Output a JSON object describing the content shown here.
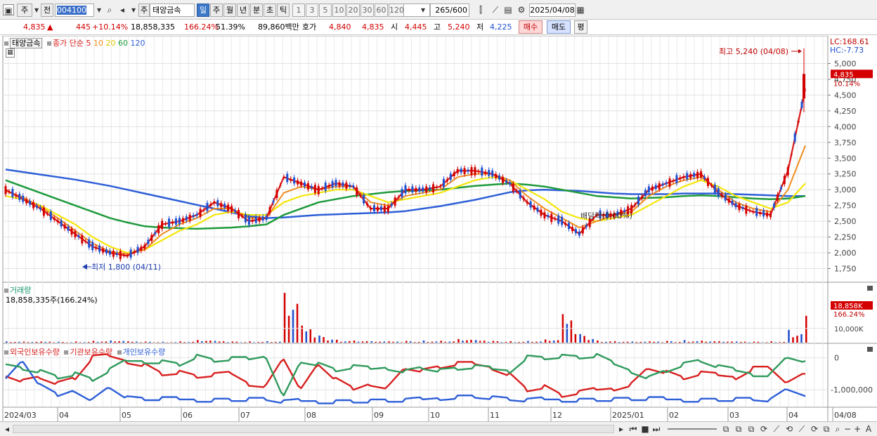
{
  "toolbar": {
    "market_label": "주",
    "prev_label": "전",
    "code": "004100",
    "stock_name": "태양금속",
    "period_tabs": [
      {
        "label": "일",
        "selected": true
      },
      {
        "label": "주",
        "selected": false
      },
      {
        "label": "월",
        "selected": false
      },
      {
        "label": "년",
        "selected": false
      },
      {
        "label": "분",
        "selected": false
      },
      {
        "label": "초",
        "selected": false
      },
      {
        "label": "틱",
        "selected": false
      }
    ],
    "interval_buttons": [
      "1",
      "3",
      "5",
      "10",
      "20",
      "30",
      "60",
      "120"
    ],
    "count": "265",
    "count_total": "/600",
    "date": "2025/04/08"
  },
  "quote": {
    "price": "4,835",
    "change_arrow": "▲",
    "change": "445",
    "change_pct": "+10.14%",
    "volume": "18,858,335",
    "volume_ratio": "166.24%",
    "turnover": "51.39%",
    "amount": "89,860백만",
    "bid_label": "호가",
    "bid1": "4,840",
    "bid2": "4,835",
    "open_label": "시",
    "open": "4,445",
    "high_label": "고",
    "high": "5,240",
    "low_label": "저",
    "low": "4,225",
    "buy_label": "매수",
    "sell_label": "매도",
    "avg_label": "평"
  },
  "legend": {
    "stock": "태양금속",
    "ma_title": "종가 단순",
    "ma_periods": [
      "5",
      "10",
      "20",
      "60",
      "120"
    ],
    "volume_title": "거래량",
    "volume_value": "18,858,335주(166.24%)",
    "holdings": [
      "외국인보유수량",
      "기관보유수량",
      "개인보유수량"
    ]
  },
  "annotations": {
    "high": "최고 5,240 (04/08)",
    "low": "최저 1,800 (04/11)",
    "dividend": "배당락(0.00%)",
    "lc": "LC:168.61",
    "hc": "HC:-7.73",
    "price_tag": "4,835",
    "pct_tag": "10.14%",
    "vol_tag": "18,858K",
    "vol_pct_tag": "166.24%"
  },
  "colors": {
    "up": "#d40000",
    "down": "#1f4fd0",
    "ma5": "#d81818",
    "ma10": "#f08c1e",
    "ma20": "#f5e60a",
    "ma60": "#1e9a3c",
    "ma120": "#2e5fd8",
    "foreign": "#d82020",
    "institution": "#2e5fd8",
    "individual": "#2f9a5c"
  },
  "chart_data": [
    {
      "type": "line",
      "title": "태양금속 일봉",
      "x_ticks": [
        "2024/03",
        "04",
        "05",
        "06",
        "07",
        "08",
        "09",
        "10",
        "11",
        "12",
        "2025/01",
        "02",
        "03",
        "04",
        "04/08"
      ],
      "ylim": [
        1600,
        5350
      ],
      "y_ticks": [
        1750,
        2000,
        2250,
        2500,
        2750,
        3000,
        3250,
        3500,
        3750,
        4000,
        4250,
        4500,
        4750,
        5000
      ],
      "series": [
        {
          "name": "5",
          "values": [
            3000,
            2850,
            2700,
            2500,
            2300,
            2100,
            2000,
            1950,
            2100,
            2450,
            2500,
            2600,
            2800,
            2700,
            2500,
            2550,
            3200,
            3100,
            3000,
            3100,
            3050,
            2700,
            2700,
            3000,
            3000,
            3050,
            3300,
            3300,
            3250,
            3100,
            2800,
            2600,
            2500,
            2300,
            2600,
            2600,
            2700,
            3000,
            3100,
            3200,
            3250,
            2950,
            2750,
            2650,
            2600,
            3300,
            4600
          ]
        },
        {
          "name": "10",
          "values": [
            2980,
            2880,
            2730,
            2550,
            2350,
            2150,
            2020,
            1980,
            2050,
            2300,
            2450,
            2550,
            2700,
            2700,
            2550,
            2550,
            2950,
            3050,
            3000,
            3050,
            3050,
            2800,
            2750,
            2900,
            2950,
            3000,
            3200,
            3250,
            3250,
            3150,
            2900,
            2700,
            2550,
            2400,
            2500,
            2600,
            2650,
            2900,
            3050,
            3150,
            3200,
            3000,
            2800,
            2700,
            2650,
            3000,
            3700
          ]
        },
        {
          "name": "20",
          "values": [
            2900,
            2850,
            2750,
            2600,
            2450,
            2250,
            2100,
            2000,
            2050,
            2200,
            2350,
            2450,
            2600,
            2650,
            2600,
            2600,
            2800,
            2900,
            2950,
            3000,
            3000,
            2900,
            2800,
            2850,
            2900,
            2950,
            3050,
            3150,
            3200,
            3150,
            3000,
            2850,
            2650,
            2550,
            2500,
            2550,
            2600,
            2750,
            2900,
            3050,
            3150,
            3050,
            2900,
            2800,
            2700,
            2800,
            3100
          ]
        },
        {
          "name": "60",
          "values": [
            3150,
            3050,
            2950,
            2850,
            2750,
            2650,
            2550,
            2480,
            2420,
            2400,
            2390,
            2380,
            2390,
            2400,
            2420,
            2450,
            2600,
            2700,
            2800,
            2850,
            2900,
            2930,
            2960,
            2980,
            2990,
            3000,
            3030,
            3060,
            3080,
            3100,
            3080,
            3050,
            3000,
            2950,
            2900,
            2880,
            2860,
            2870,
            2880,
            2900,
            2910,
            2900,
            2880,
            2860,
            2850,
            2860,
            2900
          ]
        },
        {
          "name": "120",
          "values": [
            3320,
            3280,
            3240,
            3200,
            3160,
            3110,
            3060,
            3000,
            2940,
            2880,
            2820,
            2760,
            2700,
            2640,
            2580,
            2550,
            2560,
            2580,
            2600,
            2610,
            2620,
            2630,
            2640,
            2660,
            2700,
            2740,
            2790,
            2840,
            2900,
            2960,
            2990,
            3000,
            2990,
            2980,
            2960,
            2940,
            2930,
            2930,
            2930,
            2940,
            2940,
            2940,
            2930,
            2920,
            2910,
            2900,
            2900
          ]
        }
      ]
    },
    {
      "type": "bar",
      "title": "거래량",
      "y_ticks_labels": [
        "10,000K"
      ],
      "ylim": [
        0,
        40000
      ],
      "values": [
        900,
        700,
        800,
        600,
        800,
        1200,
        1500,
        900,
        700,
        600,
        900,
        1800,
        1200,
        800,
        900,
        1000,
        35000,
        12000,
        5000,
        2000,
        1500,
        1000,
        900,
        1200,
        1500,
        1300,
        2500,
        1800,
        1200,
        1000,
        1200,
        2200,
        20000,
        6000,
        1500,
        1000,
        800,
        900,
        1200,
        1800,
        1400,
        1000,
        800,
        700,
        900,
        9000,
        18858
      ]
    },
    {
      "type": "line",
      "title": "보유수량",
      "y_ticks": [
        0,
        -1000000
      ],
      "ylim": [
        -1500000,
        300000
      ],
      "series": [
        {
          "name": "외국인보유수량",
          "values": [
            -500000,
            -700000,
            -600000,
            -800000,
            -650000,
            0,
            50000,
            -100000,
            -200000,
            -500000,
            -450000,
            -600000,
            -550000,
            -500000,
            -800000,
            -850000,
            0,
            -1000000,
            -200000,
            -700000,
            -1000000,
            -800000,
            -900000,
            -300000,
            -400000,
            -300000,
            -200000,
            -200000,
            -300000,
            -500000,
            -1000000,
            -900000,
            -1200000,
            -1100000,
            -1000000,
            -950000,
            -800000,
            -300000,
            -450000,
            -650000,
            -500000,
            -550000,
            -600000,
            -300000,
            -300000,
            -800000,
            -500000
          ]
        },
        {
          "name": "기관보유수량",
          "values": [
            -700000,
            -100000,
            -900000,
            -1200000,
            -1000000,
            -1300000,
            -900000,
            -1250000,
            -1300000,
            -1300000,
            -1300000,
            -1300000,
            -1300000,
            -1300000,
            -1300000,
            -1300000,
            -1400000,
            -1350000,
            -1350000,
            -1350000,
            -1350000,
            -1350000,
            -1350000,
            -1350000,
            -1300000,
            -1250000,
            -1200000,
            -1200000,
            -1250000,
            -1300000,
            -1350000,
            -1300000,
            -1300000,
            -1300000,
            -1300000,
            -1300000,
            -1300000,
            -1300000,
            -1300000,
            -1300000,
            -1300000,
            -1300000,
            -1300000,
            -1300000,
            -1350000,
            -1000000,
            -1200000
          ]
        },
        {
          "name": "개인보유수량",
          "values": [
            -200000,
            -300000,
            -400000,
            -600000,
            -500000,
            -700000,
            -400000,
            -100000,
            -100000,
            -100000,
            -200000,
            50000,
            -100000,
            -50000,
            -50000,
            50000,
            -1200000,
            -100000,
            -200000,
            -400000,
            -300000,
            -350000,
            -300000,
            -400000,
            -300000,
            -400000,
            -350000,
            -300000,
            -350000,
            -400000,
            50000,
            0,
            50000,
            0,
            50000,
            -200000,
            -400000,
            -600000,
            -400000,
            -200000,
            -100000,
            -300000,
            -400000,
            -500000,
            -500000,
            50000,
            -100000
          ]
        }
      ]
    }
  ]
}
